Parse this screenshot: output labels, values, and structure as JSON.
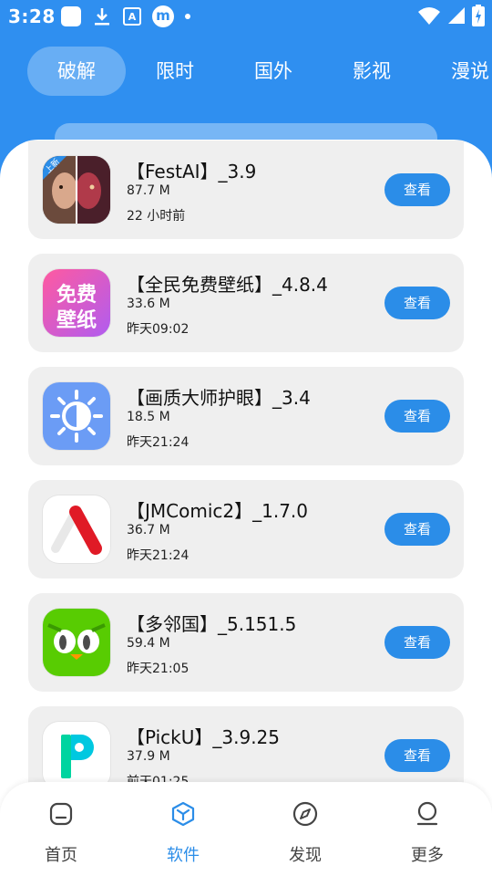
{
  "status_bar": {
    "time": "3:28",
    "icons_left": [
      "app-square-icon",
      "download-icon",
      "a-badge-icon",
      "m-app-icon",
      "dot-icon"
    ],
    "icons_right": [
      "wifi-icon",
      "signal-icon",
      "battery-charging-icon"
    ],
    "a_label": "A",
    "m_label": "m"
  },
  "tabs": [
    {
      "label": "破解",
      "active": true
    },
    {
      "label": "限时",
      "active": false
    },
    {
      "label": "国外",
      "active": false
    },
    {
      "label": "影视",
      "active": false
    },
    {
      "label": "漫说",
      "active": false
    }
  ],
  "apps": [
    {
      "name": "【FestAI】_3.9",
      "size": "87.7 M",
      "time": "22 小时前",
      "button": "查看",
      "icon": "festai-icon",
      "badge": "上新"
    },
    {
      "name": "【全民免费壁纸】_4.8.4",
      "size": "33.6 M",
      "time": "昨天09:02",
      "button": "查看",
      "icon": "wallpaper-icon",
      "icon_text_1": "免费",
      "icon_text_2": "壁纸"
    },
    {
      "name": "【画质大师护眼】_3.4",
      "size": "18.5 M",
      "time": "昨天21:24",
      "button": "查看",
      "icon": "eye-care-sun-icon"
    },
    {
      "name": "【JMComic2】_1.7.0",
      "size": "36.7 M",
      "time": "昨天21:24",
      "button": "查看",
      "icon": "jmcomic-icon"
    },
    {
      "name": "【多邻国】_5.151.5",
      "size": "59.4 M",
      "time": "昨天21:05",
      "button": "查看",
      "icon": "duolingo-owl-icon"
    },
    {
      "name": "【PickU】_3.9.25",
      "size": "37.9 M",
      "time": "前天01:25",
      "button": "查看",
      "icon": "picku-icon"
    }
  ],
  "bottom_nav": [
    {
      "label": "首页",
      "icon": "home-icon",
      "active": false
    },
    {
      "label": "软件",
      "icon": "box-icon",
      "active": true
    },
    {
      "label": "发现",
      "icon": "compass-icon",
      "active": false
    },
    {
      "label": "更多",
      "icon": "user-icon",
      "active": false
    }
  ],
  "colors": {
    "accent": "#2b8de8",
    "header": "#2f8ff0",
    "card": "#efefef"
  }
}
